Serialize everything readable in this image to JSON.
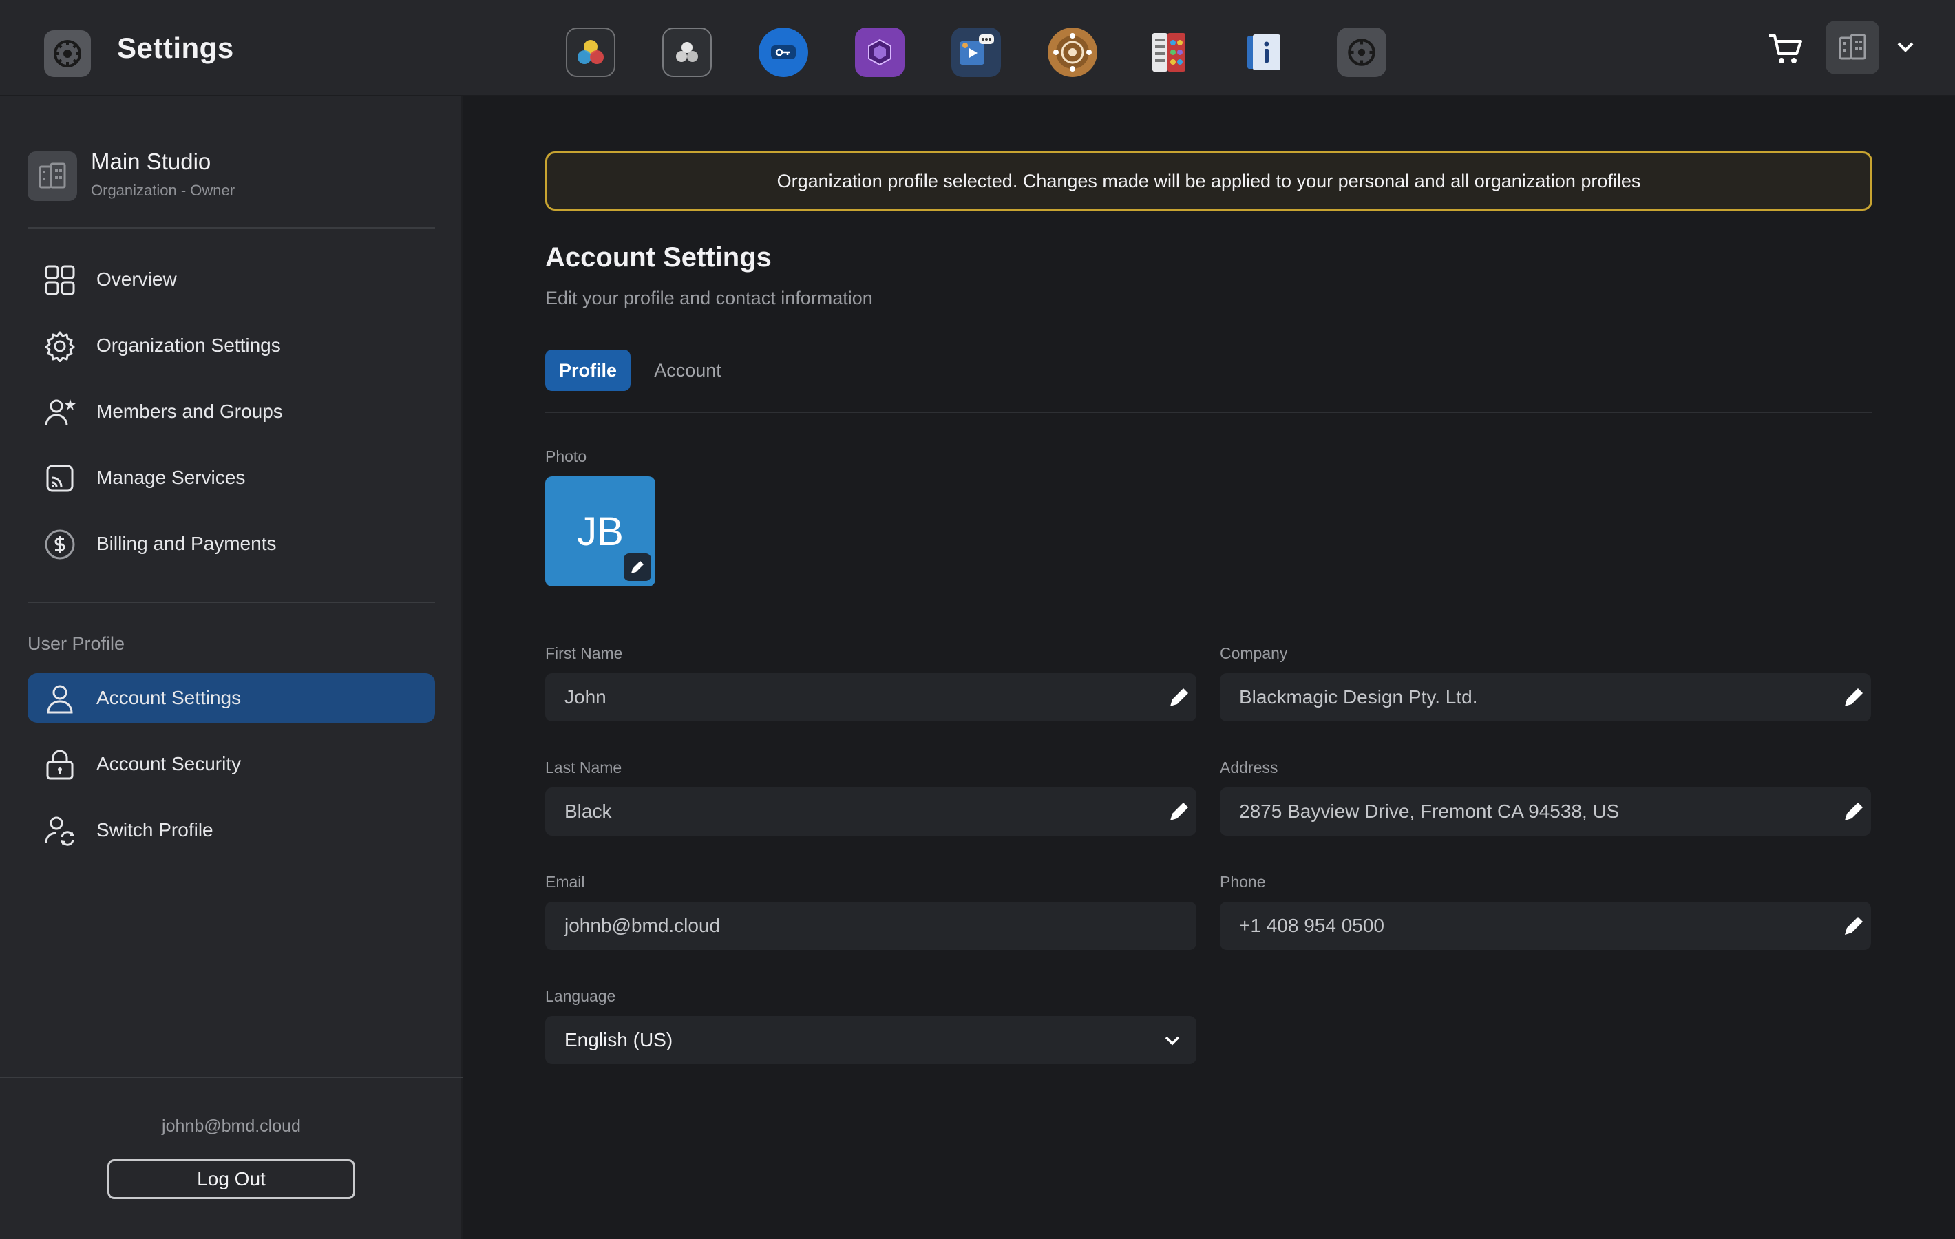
{
  "app": {
    "title": "Settings"
  },
  "dock": [
    {
      "icon": "davinci-resolve-icon"
    },
    {
      "icon": "resolve-collaboration-icon"
    },
    {
      "icon": "license-key-icon"
    },
    {
      "icon": "fusion-cube-icon"
    },
    {
      "icon": "media-presentation-icon"
    },
    {
      "icon": "network-hub-icon"
    },
    {
      "icon": "apps-library-icon"
    },
    {
      "icon": "info-book-icon"
    },
    {
      "icon": "settings-icon"
    }
  ],
  "sidebar": {
    "org_name": "Main Studio",
    "org_role": "Organization - Owner",
    "nav": [
      {
        "label": "Overview",
        "icon": "grid-icon"
      },
      {
        "label": "Organization Settings",
        "icon": "gear-icon"
      },
      {
        "label": "Members and Groups",
        "icon": "user-star-icon"
      },
      {
        "label": "Manage Services",
        "icon": "cast-icon"
      },
      {
        "label": "Billing and Payments",
        "icon": "dollar-icon"
      }
    ],
    "section_label": "User Profile",
    "profile_nav": [
      {
        "label": "Account Settings",
        "icon": "user-icon",
        "active": true
      },
      {
        "label": "Account Security",
        "icon": "lock-icon"
      },
      {
        "label": "Switch Profile",
        "icon": "switch-user-icon"
      }
    ],
    "footer_email": "johnb@bmd.cloud",
    "logout_label": "Log Out"
  },
  "main": {
    "notice": "Organization profile selected. Changes made will be applied to your personal and all organization profiles",
    "title": "Account Settings",
    "subtitle": "Edit your profile and contact information",
    "tabs": [
      {
        "label": "Profile",
        "active": true
      },
      {
        "label": "Account",
        "active": false
      }
    ],
    "photo_label": "Photo",
    "photo_initials": "JB",
    "fields": {
      "first_name": {
        "label": "First Name",
        "value": "John"
      },
      "company": {
        "label": "Company",
        "value": "Blackmagic Design Pty. Ltd."
      },
      "last_name": {
        "label": "Last Name",
        "value": "Black"
      },
      "address": {
        "label": "Address",
        "value": "2875 Bayview Drive, Fremont CA 94538, US"
      },
      "email": {
        "label": "Email",
        "value": "johnb@bmd.cloud"
      },
      "phone": {
        "label": "Phone",
        "value": "+1 408 954 0500"
      },
      "language": {
        "label": "Language",
        "value": "English (US)"
      }
    }
  },
  "colors": {
    "accent": "#1c5fa8",
    "active_nav": "#1d4a80",
    "notice_border": "#c8a431",
    "avatar": "#2d87c8"
  }
}
